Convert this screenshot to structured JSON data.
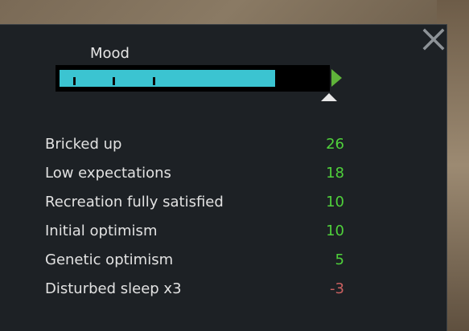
{
  "mood": {
    "label": "Mood",
    "level": 0.81,
    "target_level": 1.0,
    "threshold_ticks": [
      0.05,
      0.2,
      0.35
    ],
    "fill_color": "#3bc4d1",
    "target_arrow_color": "#5fb33a",
    "current_marker_color": "#e8e8e8"
  },
  "close": {
    "icon": "close-icon"
  },
  "thoughts": [
    {
      "label": "Bricked up",
      "value": "26",
      "sign": "pos"
    },
    {
      "label": "Low expectations",
      "value": "18",
      "sign": "pos"
    },
    {
      "label": "Recreation fully satisfied",
      "value": "10",
      "sign": "pos"
    },
    {
      "label": "Initial optimism",
      "value": "10",
      "sign": "pos"
    },
    {
      "label": "Genetic optimism",
      "value": "5",
      "sign": "pos"
    },
    {
      "label": "Disturbed sleep x3",
      "value": "-3",
      "sign": "neg"
    }
  ],
  "colors": {
    "panel_bg": "#1d2125",
    "positive": "#4fd13b",
    "negative": "#c96060"
  }
}
